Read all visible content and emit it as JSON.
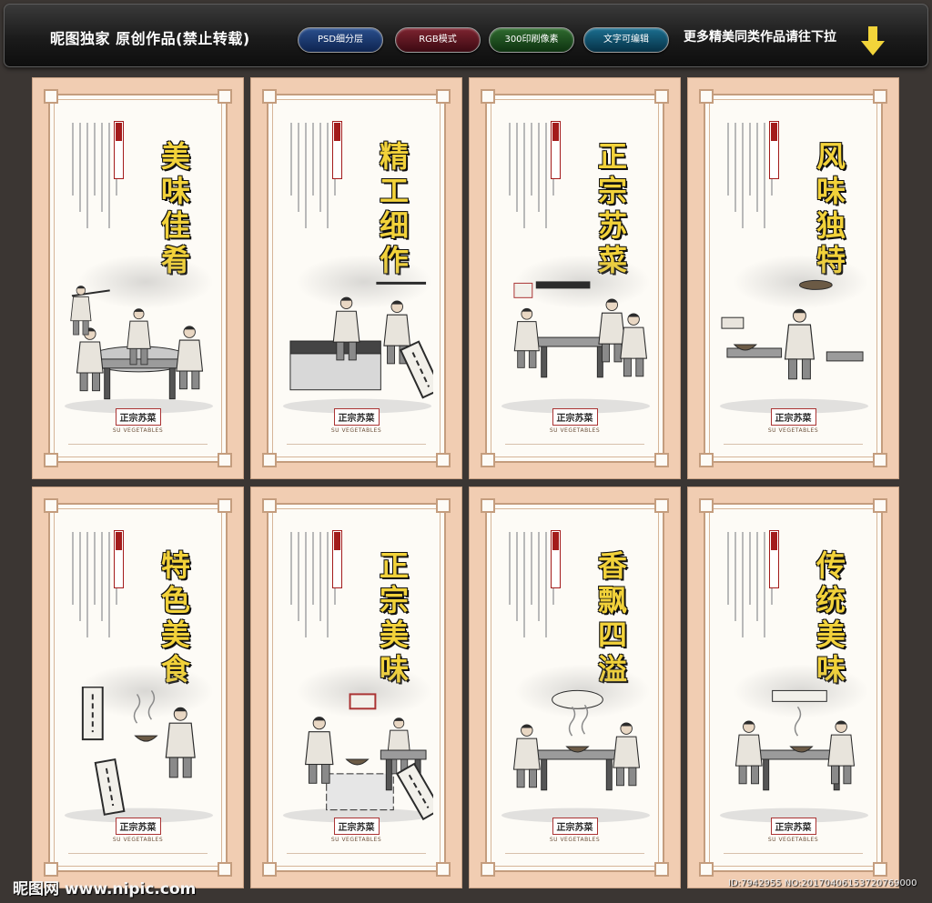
{
  "toolbar": {
    "title": "昵图独家 原创作品(禁止转载)",
    "buttons": [
      {
        "label": "PSD细分层"
      },
      {
        "label": "RGB模式"
      },
      {
        "label": "300印刷像素"
      },
      {
        "label": "文字可编辑"
      }
    ],
    "more_text": "更多精美同类作品请往下拉",
    "arrow_icon": "arrow-down-icon",
    "arrow_color": "#f2d43a"
  },
  "posters": [
    {
      "title": "美味佳肴",
      "footer_cn": "正宗苏菜",
      "footer_en": "SU VEGETABLES"
    },
    {
      "title": "精工细作",
      "footer_cn": "正宗苏菜",
      "footer_en": "SU VEGETABLES"
    },
    {
      "title": "正宗苏菜",
      "footer_cn": "正宗苏菜",
      "footer_en": "SU VEGETABLES"
    },
    {
      "title": "风味独特",
      "footer_cn": "正宗苏菜",
      "footer_en": "SU VEGETABLES"
    },
    {
      "title": "特色美食",
      "footer_cn": "正宗苏菜",
      "footer_en": "SU VEGETABLES"
    },
    {
      "title": "正宗美味",
      "footer_cn": "正宗苏菜",
      "footer_en": "SU VEGETABLES"
    },
    {
      "title": "香飘四溢",
      "footer_cn": "正宗苏菜",
      "footer_en": "SU VEGETABLES"
    },
    {
      "title": "传统美味",
      "footer_cn": "正宗苏菜",
      "footer_en": "SU VEGETABLES"
    }
  ],
  "watermark": {
    "left": "昵图网 www.nipic.com",
    "right": "ID:7942955 NO:20170406153720769000"
  },
  "colors": {
    "background": "#3b3633",
    "poster_border": "#f1cdb2",
    "title_fill": "#f2d23a"
  }
}
